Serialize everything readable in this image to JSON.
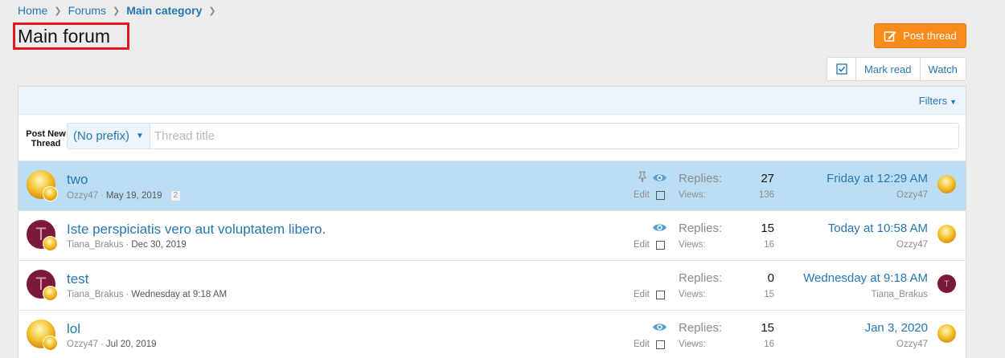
{
  "breadcrumb": {
    "items": [
      "Home",
      "Forums",
      "Main category"
    ]
  },
  "page_title": "Main forum",
  "actions": {
    "post_thread": "Post thread",
    "mark_read": "Mark read",
    "watch": "Watch"
  },
  "filters_label": "Filters",
  "new_thread": {
    "label_line1": "Post New",
    "label_line2": "Thread",
    "prefix": "(No prefix)",
    "title_placeholder": "Thread title"
  },
  "stat_labels": {
    "replies": "Replies:",
    "views": "Views:",
    "edit": "Edit"
  },
  "colors": {
    "accent": "#2577b1",
    "highlight_row": "#bcdef5",
    "post_button": "#f78b1b",
    "avatar_letter_bg": "#7a1a3a"
  },
  "threads": [
    {
      "title": "two",
      "author": "Ozzy47",
      "date": "May 19, 2019",
      "pages": "2",
      "replies": "27",
      "views": "136",
      "last_date": "Friday at 12:29 AM",
      "last_user": "Ozzy47",
      "avatar_letter": "",
      "last_avatar_letter": "",
      "icons": [
        "pin-icon",
        "eye-icon"
      ]
    },
    {
      "title": "Iste perspiciatis vero aut voluptatem libero.",
      "author": "Tiana_Brakus",
      "date": "Dec 30, 2019",
      "pages": "",
      "replies": "15",
      "views": "16",
      "last_date": "Today at 10:58 AM",
      "last_user": "Ozzy47",
      "avatar_letter": "T",
      "last_avatar_letter": "",
      "icons": [
        "eye-icon"
      ]
    },
    {
      "title": "test",
      "author": "Tiana_Brakus",
      "date": "Wednesday at 9:18 AM",
      "pages": "",
      "replies": "0",
      "views": "15",
      "last_date": "Wednesday at 9:18 AM",
      "last_user": "Tiana_Brakus",
      "avatar_letter": "T",
      "last_avatar_letter": "T",
      "icons": []
    },
    {
      "title": "lol",
      "author": "Ozzy47",
      "date": "Jul 20, 2019",
      "pages": "",
      "replies": "15",
      "views": "16",
      "last_date": "Jan 3, 2020",
      "last_user": "Ozzy47",
      "avatar_letter": "",
      "last_avatar_letter": "",
      "icons": [
        "eye-icon"
      ]
    }
  ]
}
